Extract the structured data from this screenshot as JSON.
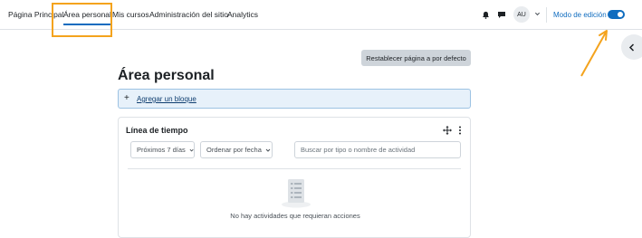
{
  "nav": {
    "items": [
      {
        "label": "Página Principal"
      },
      {
        "label": "Área personal"
      },
      {
        "label": "Mis cursos"
      },
      {
        "label": "Administración del sitio"
      },
      {
        "label": "Analytics"
      }
    ],
    "avatar_initials": "AU",
    "edit_mode_label": "Modo de edición"
  },
  "page": {
    "reset_button": "Restablecer página a por defecto",
    "title": "Área personal",
    "add_block_label": "Agregar un bloque"
  },
  "timeline": {
    "title": "Línea de tiempo",
    "filter_dropdown": "Próximos 7 días",
    "sort_dropdown": "Ordenar por fecha",
    "search_placeholder": "Buscar por tipo o nombre de actividad",
    "empty_message": "No hay actividades que requieran acciones"
  },
  "colors": {
    "accent": "#0f6cbf",
    "highlight": "#f4a31d"
  }
}
